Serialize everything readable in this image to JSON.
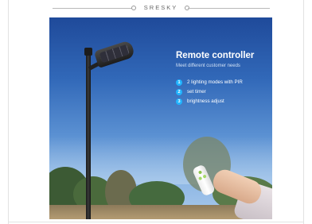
{
  "brand": {
    "name": "SRESKY"
  },
  "product": {
    "title": "Remote controller",
    "subtitle": "Meet different customer needs",
    "features": [
      {
        "num": "1",
        "label": "2 lighting modes with PIR"
      },
      {
        "num": "2",
        "label": "set timer"
      },
      {
        "num": "3",
        "label": "brightness adjust"
      }
    ]
  },
  "colors": {
    "accent": "#21b4ff",
    "sky_top": "#1f4a9a",
    "sky_bottom": "#a9c9ec",
    "title": "#ffffff"
  },
  "icons": [
    "street-light-icon",
    "remote-control-icon"
  ]
}
